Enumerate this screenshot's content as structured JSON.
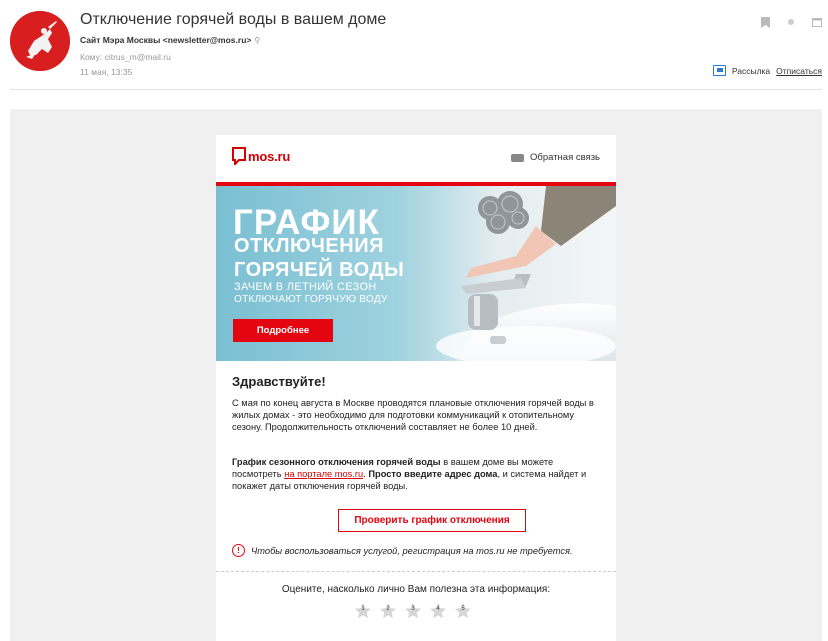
{
  "email": {
    "subject": "Отключение горячей воды в вашем доме",
    "sender": "Сайт Мэра Москвы <newsletter@mos.ru>",
    "to": "Кому: citrus_m@mail.ru",
    "date": "11 мая, 13:35",
    "newsletter_label": "Рассылка",
    "unsubscribe_label": "Отписаться"
  },
  "letter": {
    "logo_text": "mos.ru",
    "feedback_label": "Обратная связь",
    "banner": {
      "title_line1": "ГРАФИК",
      "title_line2": "ОТКЛЮЧЕНИЯ",
      "title_line3": "ГОРЯЧЕЙ ВОДЫ",
      "subtitle_line1": "ЗАЧЕМ В ЛЕТНИЙ СЕЗОН",
      "subtitle_line2": "ОТКЛЮЧАЮТ ГОРЯЧУЮ ВОДУ",
      "button_label": "Подробнее"
    },
    "greeting": "Здравствуйте!",
    "paragraph1": "С мая по конец августа в Москве проводятся плановые отключения горячей воды в жилых домах - это необходимо для подготовки коммуникаций к отопительному сезону. Продолжительность отключений составляет не более 10 дней.",
    "paragraph2_bold1": "График сезонного отключения горячей воды",
    "paragraph2_text1": " в вашем доме вы можете посмотреть ",
    "paragraph2_link": "на портале mos.ru",
    "paragraph2_text2": ". ",
    "paragraph2_bold2": "Просто введите адрес дома",
    "paragraph2_text3": ", и система найдет и покажет даты отключения горячей воды.",
    "check_button_label": "Проверить график отключения",
    "notice_text": "Чтобы воспользоваться услугой, регистрация на mos.ru не требуется.",
    "rating_prompt": "Оцените, насколько лично Вам полезна эта информация:",
    "rating_stars": [
      "1",
      "2",
      "3",
      "4",
      "5"
    ]
  },
  "colors": {
    "brand_red": "#e30611",
    "link_blue": "#2d7bd1"
  }
}
